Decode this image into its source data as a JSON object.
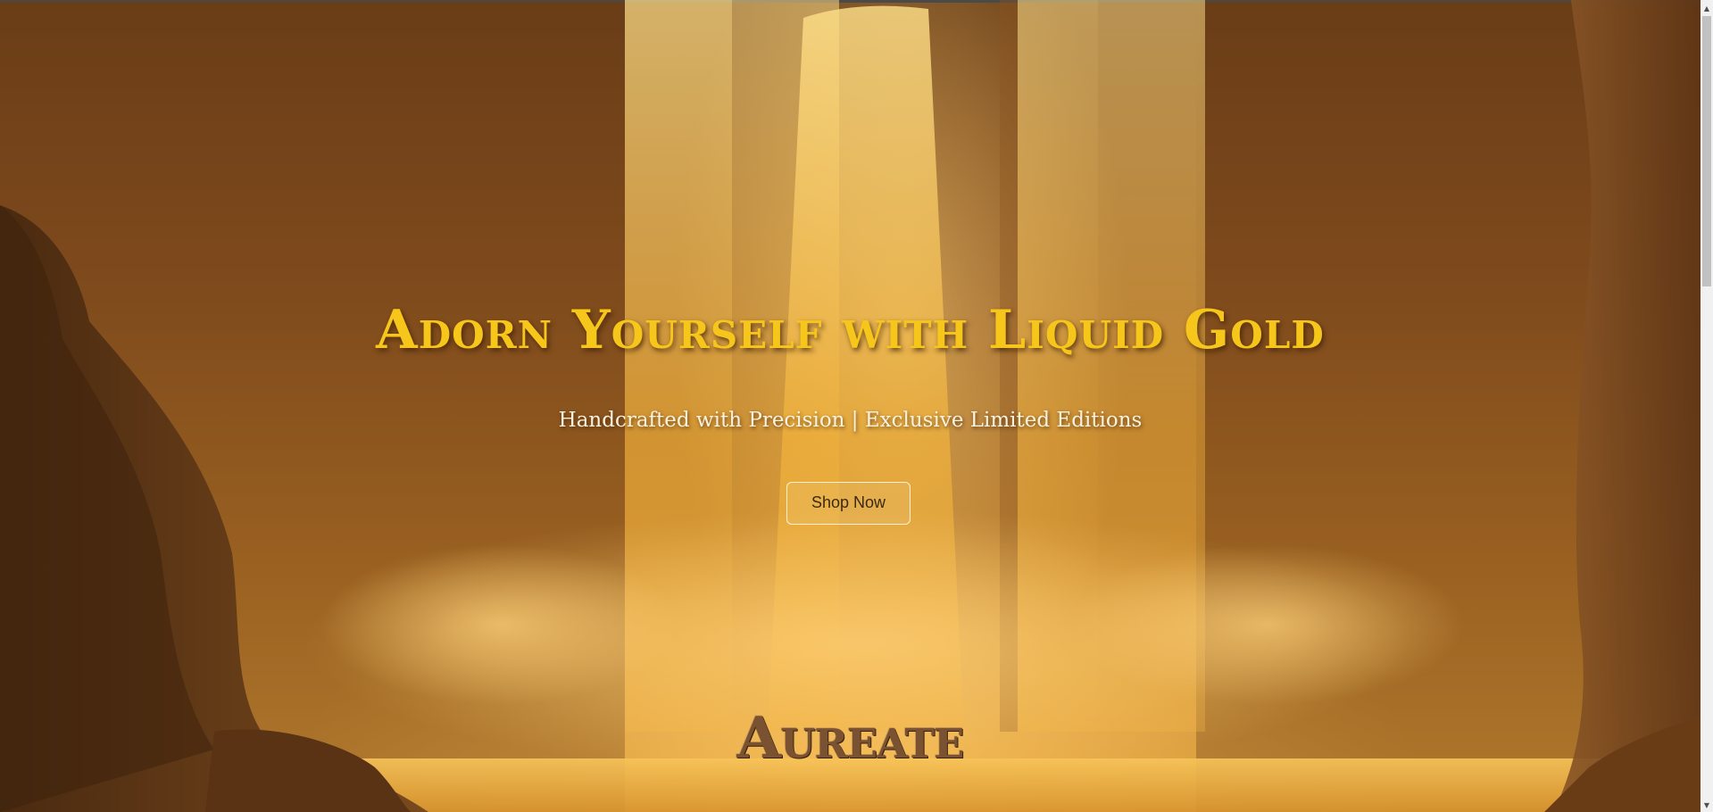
{
  "hero": {
    "title": "Adorn Yourself with Liquid Gold",
    "subtitle": "Handcrafted with Precision | Exclusive Limited Editions",
    "cta_label": "Shop Now",
    "background_image": "golden-waterfall-canyon"
  },
  "brand": {
    "logo_text": "Aureate"
  },
  "scrollbar": {
    "up_icon": "chevron-up-icon",
    "down_icon": "chevron-down-icon",
    "up_glyph": "▲",
    "down_glyph": "▼",
    "scroll_position": 0
  },
  "colors": {
    "title_gold": "#f6c61a",
    "subtitle_cream": "#fbf1dc",
    "button_border": "#fff2d2",
    "logo_bronze": "#7a5232"
  }
}
